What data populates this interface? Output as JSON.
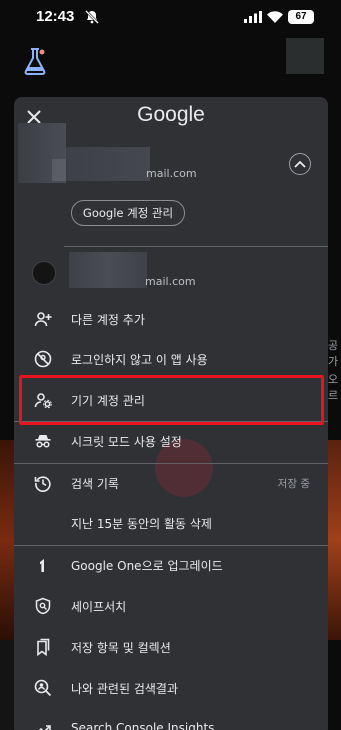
{
  "status_bar": {
    "time": "12:43",
    "battery": "67"
  },
  "sheet": {
    "title": "Google",
    "account1": {
      "email_suffix": "mail.com",
      "manage_label": "Google 계정 관리"
    },
    "account2": {
      "email_suffix": "mail.com"
    },
    "menu": [
      {
        "label": "다른 계정 추가",
        "icon": "person-add-icon"
      },
      {
        "label": "로그인하지 않고 이 앱 사용",
        "icon": "no-account-icon"
      },
      {
        "label": "기기 계정 관리",
        "icon": "manage-accounts-icon"
      },
      {
        "label": "시크릿 모드 사용 설정",
        "icon": "incognito-icon"
      },
      {
        "label": "검색 기록",
        "icon": "history-icon",
        "right": "저장 중"
      },
      {
        "label": "지난 15분 동안의 활동 삭제"
      },
      {
        "label": "Google One으로 업그레이드",
        "icon": "google-one-icon"
      },
      {
        "label": "세이프서치",
        "icon": "safesearch-icon"
      },
      {
        "label": "저장 항목 및 컬렉션",
        "icon": "saved-collections-icon"
      },
      {
        "label": "나와 관련된 검색결과",
        "icon": "results-about-you-icon"
      },
      {
        "label": "Search Console Insights",
        "icon": "trend-icon"
      }
    ]
  },
  "background": {
    "right_text_1": "공가",
    "right_text_2": "오르"
  },
  "colors": {
    "sheet": "#303134",
    "text": "#e8eaed",
    "highlight": "#e8131c"
  }
}
